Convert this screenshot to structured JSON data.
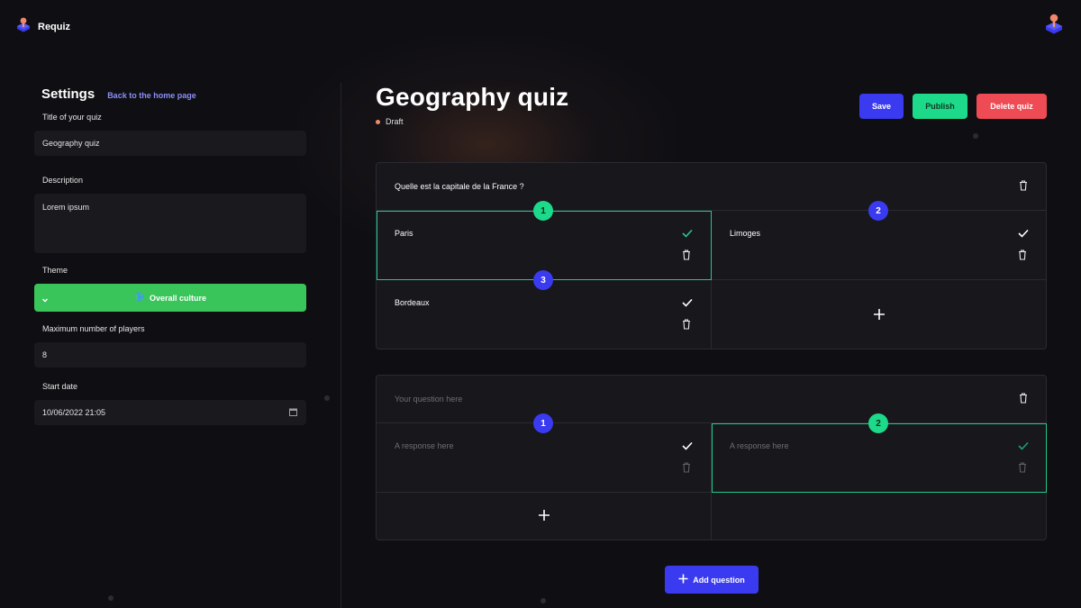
{
  "app": {
    "name": "Requiz"
  },
  "settings": {
    "title": "Settings",
    "back_link": "Back to the home page",
    "quiz_title_label": "Title of your quiz",
    "quiz_title_value": "Geography quiz",
    "description_label": "Description",
    "description_value": "Lorem ipsum",
    "theme_label": "Theme",
    "theme_value": "Overall culture",
    "max_players_label": "Maximum number of players",
    "max_players_value": "8",
    "start_date_label": "Start date",
    "start_date_value": "10/06/2022 21:05"
  },
  "quiz": {
    "title": "Geography quiz",
    "status": "Draft",
    "save_label": "Save",
    "publish_label": "Publish",
    "delete_label": "Delete quiz",
    "add_question_label": "Add question"
  },
  "questions": [
    {
      "text": "Quelle est la capitale de la France ?",
      "answers": [
        {
          "number": "1",
          "text": "Paris",
          "correct": true
        },
        {
          "number": "2",
          "text": "Limoges",
          "correct": false
        },
        {
          "number": "3",
          "text": "Bordeaux",
          "correct": false
        }
      ]
    },
    {
      "placeholder": "Your question here",
      "answers": [
        {
          "number": "1",
          "placeholder": "A response here",
          "correct": false
        },
        {
          "number": "2",
          "placeholder": "A response here",
          "correct": true
        }
      ]
    }
  ],
  "colors": {
    "background": "#0f0f13",
    "primary": "#3a3af0",
    "success": "#1dd98a",
    "danger": "#ef4b54",
    "theme_green": "#3ac55a",
    "draft_dot": "#f08b6b"
  },
  "icons": {
    "logo": "joystick-icon",
    "avatar": "joystick-icon",
    "theme": "globe-icon",
    "chevron": "chevron-down-icon",
    "check": "check-icon",
    "trash": "trash-icon",
    "plus": "plus-icon",
    "calendar": "calendar-icon"
  }
}
